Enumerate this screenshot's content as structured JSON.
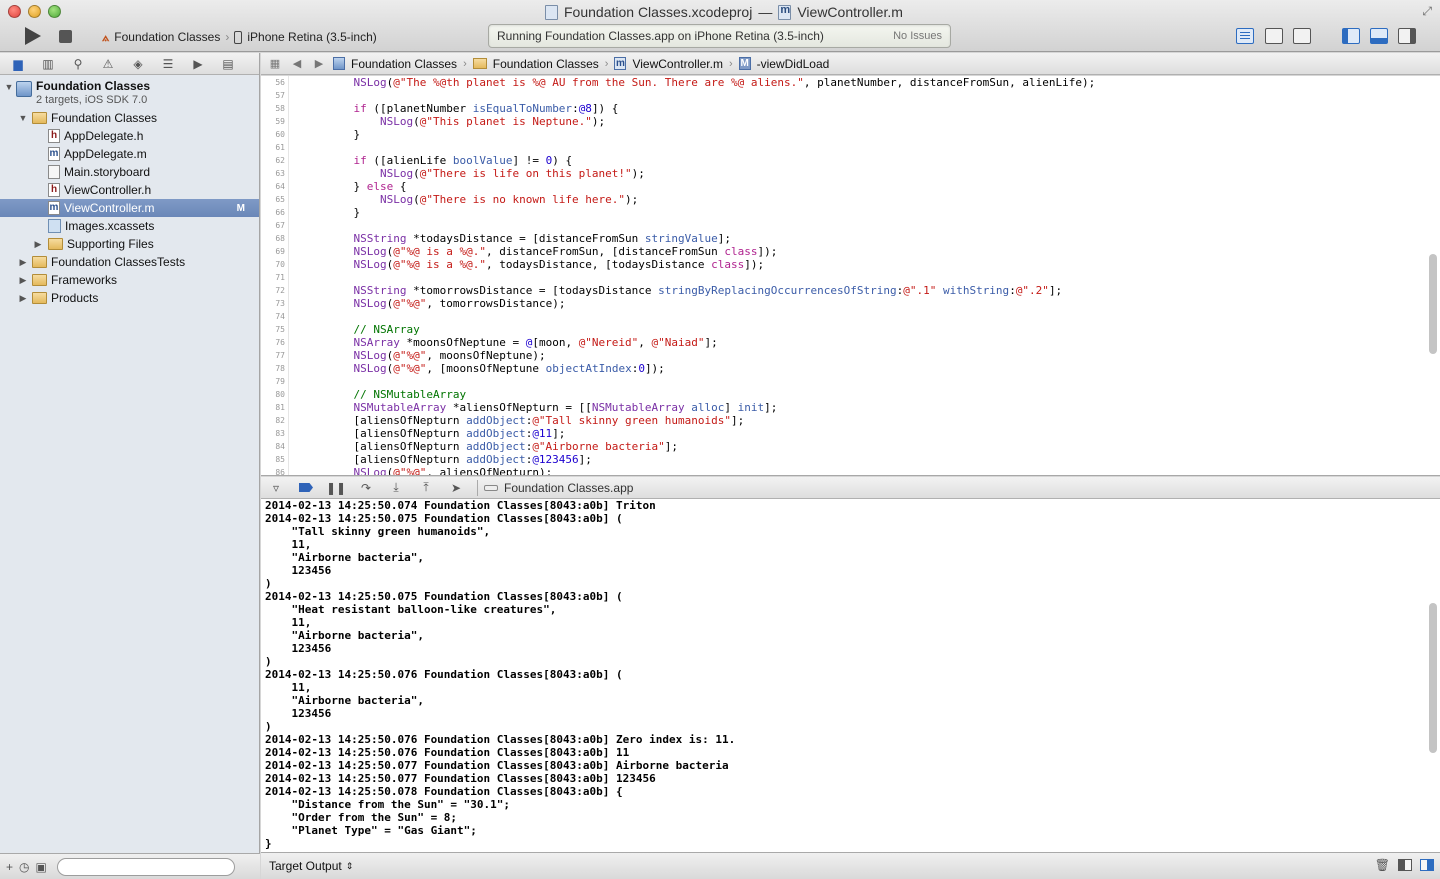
{
  "window": {
    "title_project": "Foundation Classes.xcodeproj",
    "title_dash": "—",
    "title_file": "ViewController.m"
  },
  "toolbar": {
    "scheme": "Foundation Classes",
    "destination": "iPhone Retina (3.5-inch)",
    "activity": "Running Foundation Classes.app on iPhone Retina (3.5-inch)",
    "issues": "No Issues"
  },
  "navigator": {
    "project_name": "Foundation Classes",
    "project_sub": "2 targets, iOS SDK 7.0",
    "items": [
      {
        "label": "Foundation Classes"
      },
      {
        "label": "AppDelegate.h"
      },
      {
        "label": "AppDelegate.m"
      },
      {
        "label": "Main.storyboard"
      },
      {
        "label": "ViewController.h"
      },
      {
        "label": "ViewController.m",
        "badge": "M"
      },
      {
        "label": "Images.xcassets"
      },
      {
        "label": "Supporting Files"
      },
      {
        "label": "Foundation ClassesTests"
      },
      {
        "label": "Frameworks"
      },
      {
        "label": "Products"
      }
    ]
  },
  "jumpbar": {
    "crumbs": [
      "Foundation Classes",
      "Foundation Classes",
      "ViewController.m",
      "-viewDidLoad"
    ]
  },
  "editor": {
    "line_numbers": [
      "56",
      "57",
      "58",
      "59",
      "60",
      "61",
      "62",
      "63",
      "64",
      "65",
      "66",
      "67",
      "68",
      "69",
      "70",
      "71",
      "72",
      "73",
      "74",
      "75",
      "76",
      "77",
      "78",
      "79",
      "80",
      "81",
      "82",
      "83",
      "84",
      "85",
      "86"
    ]
  },
  "debug": {
    "process": "Foundation Classes.app"
  },
  "console": {
    "lines": [
      "2014-02-13 14:25:50.074 Foundation Classes[8043:a0b] Triton",
      "2014-02-13 14:25:50.075 Foundation Classes[8043:a0b] (",
      "    \"Tall skinny green humanoids\",",
      "    11,",
      "    \"Airborne bacteria\",",
      "    123456",
      ")",
      "2014-02-13 14:25:50.075 Foundation Classes[8043:a0b] (",
      "    \"Heat resistant balloon-like creatures\",",
      "    11,",
      "    \"Airborne bacteria\",",
      "    123456",
      ")",
      "2014-02-13 14:25:50.076 Foundation Classes[8043:a0b] (",
      "    11,",
      "    \"Airborne bacteria\",",
      "    123456",
      ")",
      "2014-02-13 14:25:50.076 Foundation Classes[8043:a0b] Zero index is: 11.",
      "2014-02-13 14:25:50.076 Foundation Classes[8043:a0b] 11",
      "2014-02-13 14:25:50.077 Foundation Classes[8043:a0b] Airborne bacteria",
      "2014-02-13 14:25:50.077 Foundation Classes[8043:a0b] 123456",
      "2014-02-13 14:25:50.078 Foundation Classes[8043:a0b] {",
      "    \"Distance from the Sun\" = \"30.1\";",
      "    \"Order from the Sun\" = 8;",
      "    \"Planet Type\" = \"Gas Giant\";",
      "}"
    ],
    "output_selector": "Target Output"
  },
  "code": {
    "lines": [
      [
        [
          "t",
          "    "
        ],
        [
          "c",
          "NSLog"
        ],
        [
          "t",
          "("
        ],
        [
          "s",
          "@\"The %@th planet is %@ AU from the Sun. There are %@ aliens.\""
        ],
        [
          "t",
          ", planetNumber, distanceFromSun, alienLife);"
        ]
      ],
      [
        [
          "t",
          ""
        ]
      ],
      [
        [
          "t",
          "    "
        ],
        [
          "k",
          "if"
        ],
        [
          "t",
          " ([planetNumber "
        ],
        [
          "m",
          "isEqualToNumber"
        ],
        [
          "t",
          ":"
        ],
        [
          "n",
          "@8"
        ],
        [
          "t",
          "]) {"
        ]
      ],
      [
        [
          "t",
          "        "
        ],
        [
          "c",
          "NSLog"
        ],
        [
          "t",
          "("
        ],
        [
          "s",
          "@\"This planet is Neptune.\""
        ],
        [
          "t",
          ");"
        ]
      ],
      [
        [
          "t",
          "    }"
        ]
      ],
      [
        [
          "t",
          ""
        ]
      ],
      [
        [
          "t",
          "    "
        ],
        [
          "k",
          "if"
        ],
        [
          "t",
          " ([alienLife "
        ],
        [
          "m",
          "boolValue"
        ],
        [
          "t",
          "] != "
        ],
        [
          "n",
          "0"
        ],
        [
          "t",
          ") {"
        ]
      ],
      [
        [
          "t",
          "        "
        ],
        [
          "c",
          "NSLog"
        ],
        [
          "t",
          "("
        ],
        [
          "s",
          "@\"There is life on this planet!\""
        ],
        [
          "t",
          ");"
        ]
      ],
      [
        [
          "t",
          "    } "
        ],
        [
          "k",
          "else"
        ],
        [
          "t",
          " {"
        ]
      ],
      [
        [
          "t",
          "        "
        ],
        [
          "c",
          "NSLog"
        ],
        [
          "t",
          "("
        ],
        [
          "s",
          "@\"There is no known life here.\""
        ],
        [
          "t",
          ");"
        ]
      ],
      [
        [
          "t",
          "    }"
        ]
      ],
      [
        [
          "t",
          ""
        ]
      ],
      [
        [
          "t",
          "    "
        ],
        [
          "c",
          "NSString"
        ],
        [
          "t",
          " *todaysDistance = [distanceFromSun "
        ],
        [
          "m",
          "stringValue"
        ],
        [
          "t",
          "];"
        ]
      ],
      [
        [
          "t",
          "    "
        ],
        [
          "c",
          "NSLog"
        ],
        [
          "t",
          "("
        ],
        [
          "s",
          "@\"%@ is a %@.\""
        ],
        [
          "t",
          ", distanceFromSun, [distanceFromSun "
        ],
        [
          "k",
          "class"
        ],
        [
          "t",
          "]);"
        ]
      ],
      [
        [
          "t",
          "    "
        ],
        [
          "c",
          "NSLog"
        ],
        [
          "t",
          "("
        ],
        [
          "s",
          "@\"%@ is a %@.\""
        ],
        [
          "t",
          ", todaysDistance, [todaysDistance "
        ],
        [
          "k",
          "class"
        ],
        [
          "t",
          "]);"
        ]
      ],
      [
        [
          "t",
          ""
        ]
      ],
      [
        [
          "t",
          "    "
        ],
        [
          "c",
          "NSString"
        ],
        [
          "t",
          " *tomorrowsDistance = [todaysDistance "
        ],
        [
          "m",
          "stringByReplacingOccurrencesOfString"
        ],
        [
          "t",
          ":"
        ],
        [
          "s",
          "@\".1\""
        ],
        [
          "t",
          " "
        ],
        [
          "m",
          "withString"
        ],
        [
          "t",
          ":"
        ],
        [
          "s",
          "@\".2\""
        ],
        [
          "t",
          "];"
        ]
      ],
      [
        [
          "t",
          "    "
        ],
        [
          "c",
          "NSLog"
        ],
        [
          "t",
          "("
        ],
        [
          "s",
          "@\"%@\""
        ],
        [
          "t",
          ", tomorrowsDistance);"
        ]
      ],
      [
        [
          "t",
          ""
        ]
      ],
      [
        [
          "t",
          "    "
        ],
        [
          "g",
          "// NSArray"
        ]
      ],
      [
        [
          "t",
          "    "
        ],
        [
          "c",
          "NSArray"
        ],
        [
          "t",
          " *moonsOfNeptune = "
        ],
        [
          "n",
          "@"
        ],
        [
          "t",
          "[moon, "
        ],
        [
          "s",
          "@\"Nereid\""
        ],
        [
          "t",
          ", "
        ],
        [
          "s",
          "@\"Naiad\""
        ],
        [
          "t",
          "];"
        ]
      ],
      [
        [
          "t",
          "    "
        ],
        [
          "c",
          "NSLog"
        ],
        [
          "t",
          "("
        ],
        [
          "s",
          "@\"%@\""
        ],
        [
          "t",
          ", moonsOfNeptune);"
        ]
      ],
      [
        [
          "t",
          "    "
        ],
        [
          "c",
          "NSLog"
        ],
        [
          "t",
          "("
        ],
        [
          "s",
          "@\"%@\""
        ],
        [
          "t",
          ", [moonsOfNeptune "
        ],
        [
          "m",
          "objectAtIndex"
        ],
        [
          "t",
          ":"
        ],
        [
          "n",
          "0"
        ],
        [
          "t",
          "]);"
        ]
      ],
      [
        [
          "t",
          ""
        ]
      ],
      [
        [
          "t",
          "    "
        ],
        [
          "g",
          "// NSMutableArray"
        ]
      ],
      [
        [
          "t",
          "    "
        ],
        [
          "c",
          "NSMutableArray"
        ],
        [
          "t",
          " *aliensOfNepturn = [["
        ],
        [
          "c",
          "NSMutableArray"
        ],
        [
          "t",
          " "
        ],
        [
          "m",
          "alloc"
        ],
        [
          "t",
          "] "
        ],
        [
          "m",
          "init"
        ],
        [
          "t",
          "];"
        ]
      ],
      [
        [
          "t",
          "    [aliensOfNepturn "
        ],
        [
          "m",
          "addObject"
        ],
        [
          "t",
          ":"
        ],
        [
          "s",
          "@\"Tall skinny green humanoids\""
        ],
        [
          "t",
          "];"
        ]
      ],
      [
        [
          "t",
          "    [aliensOfNepturn "
        ],
        [
          "m",
          "addObject"
        ],
        [
          "t",
          ":"
        ],
        [
          "n",
          "@11"
        ],
        [
          "t",
          "];"
        ]
      ],
      [
        [
          "t",
          "    [aliensOfNepturn "
        ],
        [
          "m",
          "addObject"
        ],
        [
          "t",
          ":"
        ],
        [
          "s",
          "@\"Airborne bacteria\""
        ],
        [
          "t",
          "];"
        ]
      ],
      [
        [
          "t",
          "    [aliensOfNepturn "
        ],
        [
          "m",
          "addObject"
        ],
        [
          "t",
          ":"
        ],
        [
          "n",
          "@123456"
        ],
        [
          "t",
          "];"
        ]
      ],
      [
        [
          "t",
          "    "
        ],
        [
          "c",
          "NSLog"
        ],
        [
          "t",
          "("
        ],
        [
          "s",
          "@\"%@\""
        ],
        [
          "t",
          ", aliensOfNepturn);"
        ]
      ]
    ]
  }
}
